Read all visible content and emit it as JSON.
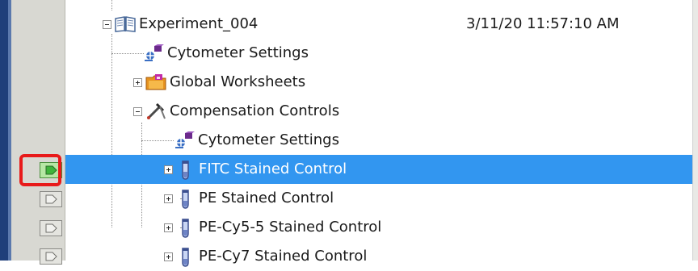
{
  "tree": {
    "experiment": {
      "label": "Experiment_004",
      "date": "3/11/20 11:57:10 AM"
    },
    "nodes": [
      {
        "label": "Cytometer Settings"
      },
      {
        "label": "Global Worksheets"
      },
      {
        "label": "Compensation Controls"
      },
      {
        "label": "Cytometer Settings"
      },
      {
        "label": "FITC Stained Control"
      },
      {
        "label": "PE Stained Control"
      },
      {
        "label": "PE-Cy5-5 Stained Control"
      },
      {
        "label": "PE-Cy7 Stained Control"
      }
    ],
    "selected": "FITC Stained Control"
  },
  "colors": {
    "selection": "#3296f0",
    "highlight": "#e81a1a",
    "active_button": "#b7e7a4"
  },
  "icons": {
    "experiment": "open-book-icon",
    "cytometer": "cytometer-settings-icon",
    "worksheets": "folder-icon",
    "compensation": "compensation-tools-icon",
    "tube": "test-tube-icon",
    "launch": "play-arrow-icon"
  }
}
